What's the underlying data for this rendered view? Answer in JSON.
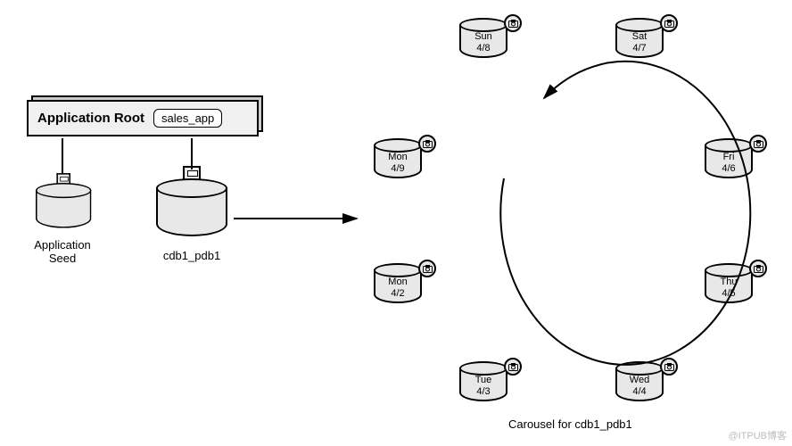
{
  "appRoot": {
    "label": "Application Root",
    "appName": "sales_app"
  },
  "left": {
    "seed": {
      "line1": "Application",
      "line2": "Seed"
    },
    "pdb": {
      "label": "cdb1_pdb1"
    }
  },
  "carousel": {
    "caption": "Carousel for cdb1_pdb1",
    "nodes": [
      {
        "id": "sun",
        "day": "Sun",
        "date": "4/8"
      },
      {
        "id": "sat",
        "day": "Sat",
        "date": "4/7"
      },
      {
        "id": "fri",
        "day": "Fri",
        "date": "4/6"
      },
      {
        "id": "thu",
        "day": "Thu",
        "date": "4/5"
      },
      {
        "id": "wed",
        "day": "Wed",
        "date": "4/4"
      },
      {
        "id": "tue",
        "day": "Tue",
        "date": "4/3"
      },
      {
        "id": "mon2",
        "day": "Mon",
        "date": "4/2"
      },
      {
        "id": "mon9",
        "day": "Mon",
        "date": "4/9"
      }
    ]
  },
  "watermark": "@ITPUB博客"
}
